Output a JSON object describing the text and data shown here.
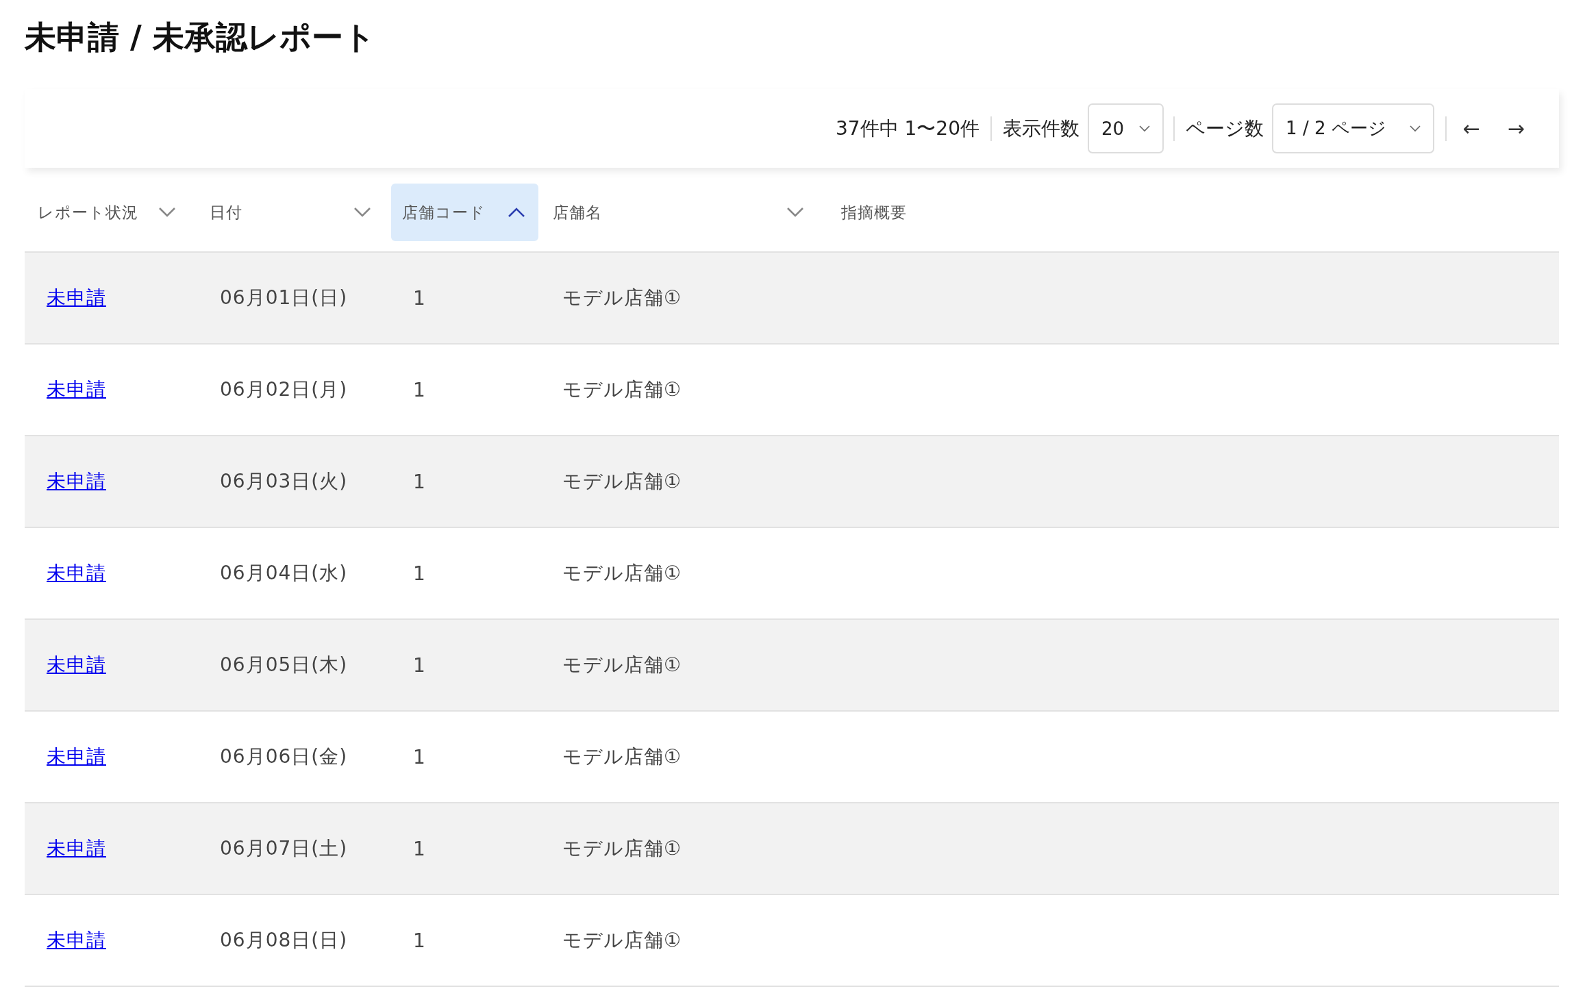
{
  "title": "未申請 / 未承認レポート",
  "pager": {
    "range": "37件中 1〜20件",
    "page_size_label": "表示件数",
    "page_size": "20",
    "page_label": "ページ数",
    "page": "1 / 2 ページ",
    "prev": "←",
    "next": "→"
  },
  "table": {
    "columns": [
      {
        "label": "レポート状況",
        "kind": "sortable",
        "selected": false
      },
      {
        "label": "日付",
        "kind": "sortable",
        "selected": false
      },
      {
        "label": "店舗コード",
        "kind": "sortable",
        "selected": true
      },
      {
        "label": "店舗名",
        "kind": "sortable",
        "selected": false
      },
      {
        "label": "指摘概要",
        "kind": "plain",
        "selected": false
      }
    ],
    "rows": [
      {
        "status": "未申請",
        "date": "06月01日(日)",
        "code": "1",
        "store": "モデル店舗①"
      },
      {
        "status": "未申請",
        "date": "06月02日(月)",
        "code": "1",
        "store": "モデル店舗①"
      },
      {
        "status": "未申請",
        "date": "06月03日(火)",
        "code": "1",
        "store": "モデル店舗①"
      },
      {
        "status": "未申請",
        "date": "06月04日(水)",
        "code": "1",
        "store": "モデル店舗①"
      },
      {
        "status": "未申請",
        "date": "06月05日(木)",
        "code": "1",
        "store": "モデル店舗①"
      },
      {
        "status": "未申請",
        "date": "06月06日(金)",
        "code": "1",
        "store": "モデル店舗①"
      },
      {
        "status": "未申請",
        "date": "06月07日(土)",
        "code": "1",
        "store": "モデル店舗①"
      },
      {
        "status": "未申請",
        "date": "06月08日(日)",
        "code": "1",
        "store": "モデル店舗①"
      }
    ]
  }
}
